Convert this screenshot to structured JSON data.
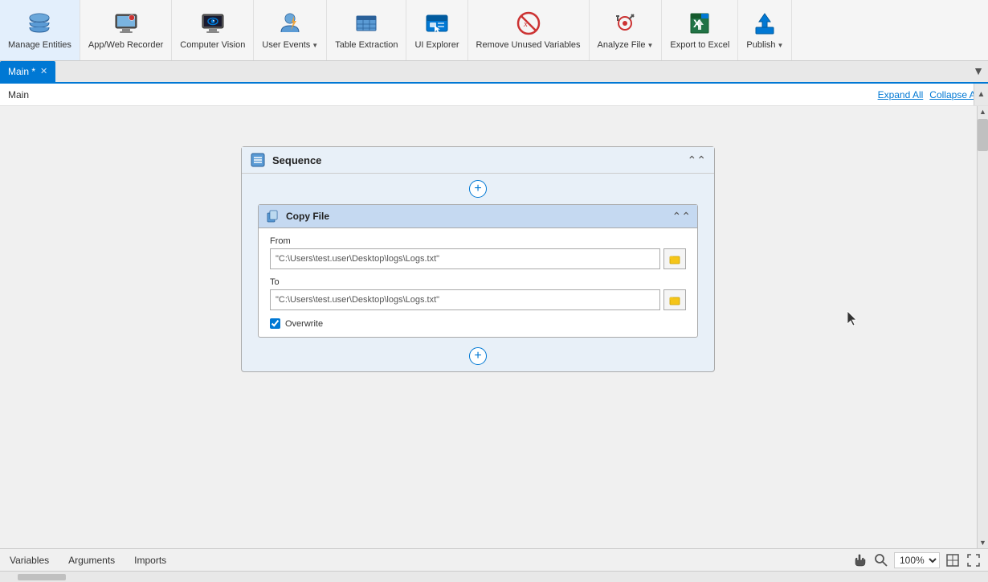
{
  "toolbar": {
    "items": [
      {
        "id": "manage-entities",
        "label": "Manage\nEntities",
        "icon": "database"
      },
      {
        "id": "app-web-recorder",
        "label": "App/Web\nRecorder",
        "icon": "monitor"
      },
      {
        "id": "computer-vision",
        "label": "Computer\nVision",
        "icon": "eye"
      },
      {
        "id": "user-events",
        "label": "User\nEvents",
        "icon": "user-events",
        "hasDropdown": true
      },
      {
        "id": "table-extraction",
        "label": "Table\nExtraction",
        "icon": "table"
      },
      {
        "id": "ui-explorer",
        "label": "UI\nExplorer",
        "icon": "ui-explorer"
      },
      {
        "id": "remove-unused-variables",
        "label": "Remove Unused\nVariables",
        "icon": "remove-variables"
      },
      {
        "id": "analyze-file",
        "label": "Analyze\nFile",
        "icon": "analyze",
        "hasDropdown": true
      },
      {
        "id": "export-to-excel",
        "label": "Export\nto Excel",
        "icon": "excel"
      },
      {
        "id": "publish",
        "label": "Publish",
        "icon": "publish",
        "hasDropdown": true
      }
    ]
  },
  "tabs": [
    {
      "id": "main-tab",
      "label": "Main *",
      "closeable": true
    }
  ],
  "breadcrumb": {
    "text": "Main"
  },
  "expand_all": "Expand All",
  "collapse_all": "Collapse All",
  "sequence": {
    "title": "Sequence"
  },
  "activity": {
    "title": "Copy File",
    "from_label": "From",
    "from_value": "\"C:\\Users\\test.user\\Desktop\\logs\\Logs.txt\"",
    "to_label": "To",
    "to_value": "\"C:\\Users\\test.user\\Desktop\\logs\\Logs.txt\"",
    "overwrite_label": "Overwrite",
    "overwrite_checked": true
  },
  "statusbar": {
    "variables": "Variables",
    "arguments": "Arguments",
    "imports": "Imports",
    "zoom": "100%"
  }
}
